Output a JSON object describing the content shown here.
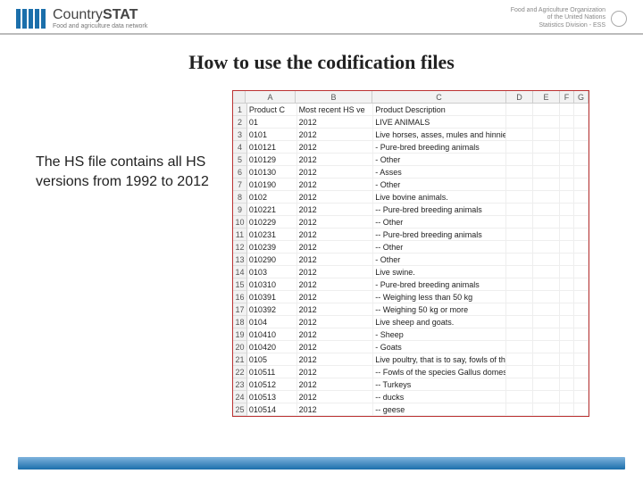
{
  "header": {
    "brand_country": "Country",
    "brand_stat": "STAT",
    "brand_sub": "Food and agriculture data network",
    "org_lines": [
      "Food and Agriculture Organization",
      "of the United Nations",
      "Statistics Division - ESS"
    ]
  },
  "title": "How to use the codification files",
  "body_text": "The HS file contains all HS versions from 1992 to 2012",
  "spreadsheet": {
    "columns": [
      "A",
      "B",
      "C",
      "D",
      "E",
      "F",
      "G"
    ],
    "header_row": {
      "A": "Product C",
      "B": "Most recent HS ve",
      "C": "Product Description"
    },
    "rows": [
      {
        "n": 1,
        "A": "Product C",
        "B": "Most recent HS ve",
        "C": "Product Description"
      },
      {
        "n": 2,
        "A": "01",
        "B": "2012",
        "C": "LIVE ANIMALS"
      },
      {
        "n": 3,
        "A": "0101",
        "B": "2012",
        "C": "Live horses, asses, mules and hinnies."
      },
      {
        "n": 4,
        "A": "010121",
        "B": "2012",
        "C": "- Pure-bred breeding animals"
      },
      {
        "n": 5,
        "A": "010129",
        "B": "2012",
        "C": "- Other"
      },
      {
        "n": 6,
        "A": "010130",
        "B": "2012",
        "C": "- Asses"
      },
      {
        "n": 7,
        "A": "010190",
        "B": "2012",
        "C": "- Other"
      },
      {
        "n": 8,
        "A": "0102",
        "B": "2012",
        "C": "Live bovine animals."
      },
      {
        "n": 9,
        "A": "010221",
        "B": "2012",
        "C": "-- Pure-bred breeding animals"
      },
      {
        "n": 10,
        "A": "010229",
        "B": "2012",
        "C": "-- Other"
      },
      {
        "n": 11,
        "A": "010231",
        "B": "2012",
        "C": "-- Pure-bred breeding animals"
      },
      {
        "n": 12,
        "A": "010239",
        "B": "2012",
        "C": "-- Other"
      },
      {
        "n": 13,
        "A": "010290",
        "B": "2012",
        "C": "- Other"
      },
      {
        "n": 14,
        "A": "0103",
        "B": "2012",
        "C": "Live swine."
      },
      {
        "n": 15,
        "A": "010310",
        "B": "2012",
        "C": "- Pure-bred breeding animals"
      },
      {
        "n": 16,
        "A": "010391",
        "B": "2012",
        "C": "-- Weighing less than 50 kg"
      },
      {
        "n": 17,
        "A": "010392",
        "B": "2012",
        "C": "-- Weighing 50 kg or more"
      },
      {
        "n": 18,
        "A": "0104",
        "B": "2012",
        "C": "Live sheep and goats."
      },
      {
        "n": 19,
        "A": "010410",
        "B": "2012",
        "C": "- Sheep"
      },
      {
        "n": 20,
        "A": "010420",
        "B": "2012",
        "C": "- Goats"
      },
      {
        "n": 21,
        "A": "0105",
        "B": "2012",
        "C": "Live poultry, that is to say, fowls of the species Gall."
      },
      {
        "n": 22,
        "A": "010511",
        "B": "2012",
        "C": "-- Fowls of the species Gallus domesticus"
      },
      {
        "n": 23,
        "A": "010512",
        "B": "2012",
        "C": "-- Turkeys"
      },
      {
        "n": 24,
        "A": "010513",
        "B": "2012",
        "C": "-- ducks"
      },
      {
        "n": 25,
        "A": "010514",
        "B": "2012",
        "C": "-- geese"
      }
    ]
  }
}
